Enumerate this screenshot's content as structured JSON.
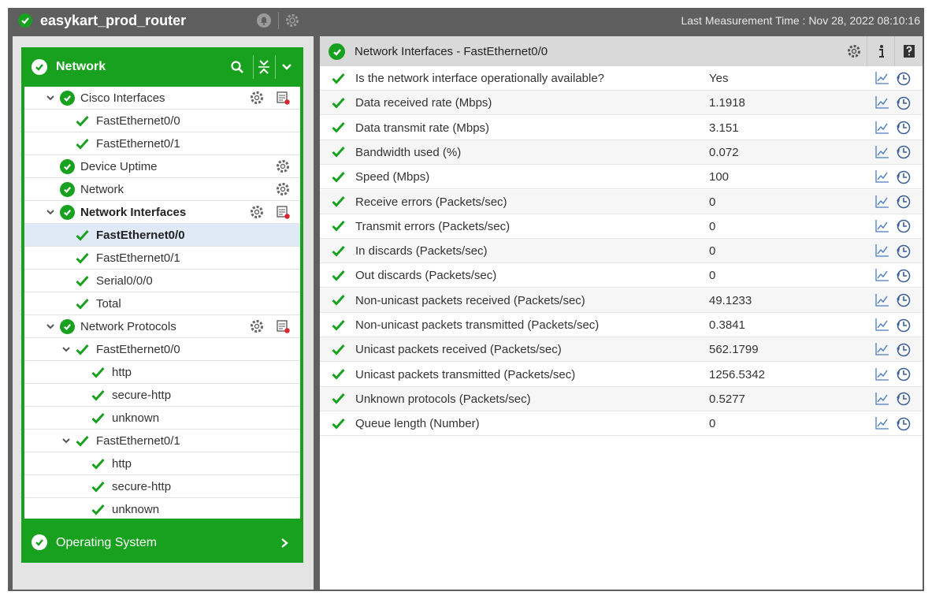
{
  "window": {
    "title": "easykart_prod_router",
    "measurement_label": "Last Measurement Time : Nov 28, 2022 08:10:16",
    "icons": [
      "status-check-icon",
      "alarm-icon",
      "config-gear-icon"
    ]
  },
  "sidebar": {
    "group_title": "Network",
    "group_icons": [
      "search-icon",
      "collapse-all-icon",
      "chevron-down-icon"
    ],
    "tree": [
      {
        "label": "Cisco Interfaces"
      },
      {
        "label": "FastEthernet0/0"
      },
      {
        "label": "FastEthernet0/1"
      },
      {
        "label": "Device Uptime"
      },
      {
        "label": "Network"
      },
      {
        "label": "Network Interfaces"
      },
      {
        "label": "FastEthernet0/0"
      },
      {
        "label": "FastEthernet0/1"
      },
      {
        "label": "Serial0/0/0"
      },
      {
        "label": "Total"
      },
      {
        "label": "Network Protocols"
      },
      {
        "label": "FastEthernet0/0"
      },
      {
        "label": "http"
      },
      {
        "label": "secure-http"
      },
      {
        "label": "unknown"
      },
      {
        "label": "FastEthernet0/1"
      },
      {
        "label": "http"
      },
      {
        "label": "secure-http"
      },
      {
        "label": "unknown"
      }
    ],
    "selected_index": 6,
    "os_group_title": "Operating System"
  },
  "main": {
    "title": "Network Interfaces - FastEthernet0/0",
    "header_buttons": [
      "config-gear-icon",
      "info-icon",
      "help-icon"
    ],
    "measures": [
      {
        "name": "Is the network interface operationally available?",
        "value": "Yes"
      },
      {
        "name": "Data received rate (Mbps)",
        "value": "1.1918"
      },
      {
        "name": "Data transmit rate (Mbps)",
        "value": "3.151"
      },
      {
        "name": "Bandwidth used (%)",
        "value": "0.072"
      },
      {
        "name": "Speed (Mbps)",
        "value": "100"
      },
      {
        "name": "Receive errors (Packets/sec)",
        "value": "0"
      },
      {
        "name": "Transmit errors (Packets/sec)",
        "value": "0"
      },
      {
        "name": "In discards (Packets/sec)",
        "value": "0"
      },
      {
        "name": "Out discards (Packets/sec)",
        "value": "0"
      },
      {
        "name": "Non-unicast packets received (Packets/sec)",
        "value": "49.1233"
      },
      {
        "name": "Non-unicast packets transmitted (Packets/sec)",
        "value": "0.3841"
      },
      {
        "name": "Unicast packets received (Packets/sec)",
        "value": "562.1799"
      },
      {
        "name": "Unicast packets transmitted (Packets/sec)",
        "value": "1256.5342"
      },
      {
        "name": "Unknown protocols (Packets/sec)",
        "value": "0.5277"
      },
      {
        "name": "Queue length (Number)",
        "value": "0"
      }
    ],
    "row_icons": [
      "graph-icon",
      "history-icon"
    ]
  },
  "colors": {
    "status_green": "#17a11e",
    "titlebar": "#5f5f5f",
    "selected_row": "#dfeaf6"
  }
}
